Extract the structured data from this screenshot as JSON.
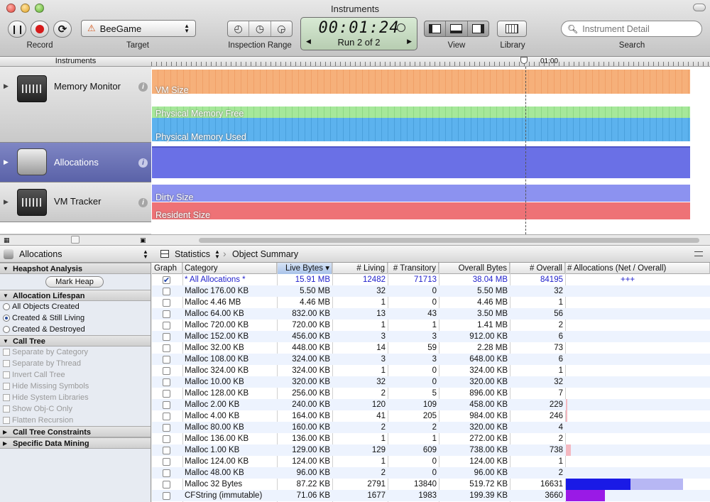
{
  "window": {
    "title": "Instruments"
  },
  "toolbar": {
    "record_label": "Record",
    "target_label": "Target",
    "target_value": "BeeGame",
    "inspection_label": "Inspection Range",
    "timer": "00:01:24",
    "run": "Run 2 of 2",
    "view_label": "View",
    "library_label": "Library",
    "search_label": "Search",
    "search_placeholder": "Instrument Detail"
  },
  "instruments_header": "Instruments",
  "ruler": {
    "marker_label": "01:00"
  },
  "instruments": [
    {
      "name": "Memory Monitor",
      "lanes": [
        "VM Size",
        "Physical Memory Free",
        "Physical Memory Used"
      ]
    },
    {
      "name": "Allocations",
      "lanes": []
    },
    {
      "name": "VM Tracker",
      "lanes": [
        "Dirty Size",
        "Resident Size"
      ]
    }
  ],
  "sidebar": {
    "title": "Allocations",
    "sections": {
      "heapshot": "Heapshot Analysis",
      "mark_heap": "Mark Heap",
      "lifespan": "Allocation Lifespan",
      "lifespan_options": [
        "All Objects Created",
        "Created & Still Living",
        "Created & Destroyed"
      ],
      "lifespan_selected": 1,
      "call_tree": "Call Tree",
      "call_tree_options": [
        "Separate by Category",
        "Separate by Thread",
        "Invert Call Tree",
        "Hide Missing Symbols",
        "Hide System Libraries",
        "Show Obj-C Only",
        "Flatten Recursion"
      ],
      "constraints": "Call Tree Constraints",
      "data_mining": "Specific Data Mining"
    }
  },
  "breadcrumb": {
    "view": "Statistics",
    "detail": "Object Summary"
  },
  "table": {
    "columns": [
      "Graph",
      "Category",
      "Live Bytes",
      "# Living",
      "# Transitory",
      "Overall Bytes",
      "# Overall",
      "# Allocations (Net / Overall)"
    ],
    "all_row": {
      "category": "* All Allocations *",
      "live": "15.91 MB",
      "living": "12482",
      "transitory": "71713",
      "overall_bytes": "38.04 MB",
      "overall": "84195",
      "graph": "+++"
    },
    "rows": [
      {
        "category": "Malloc 176.00 KB",
        "live": "5.50 MB",
        "living": "32",
        "transitory": "0",
        "overall_bytes": "5.50 MB",
        "overall": "32"
      },
      {
        "category": "Malloc 4.46 MB",
        "live": "4.46 MB",
        "living": "1",
        "transitory": "0",
        "overall_bytes": "4.46 MB",
        "overall": "1"
      },
      {
        "category": "Malloc 64.00 KB",
        "live": "832.00 KB",
        "living": "13",
        "transitory": "43",
        "overall_bytes": "3.50 MB",
        "overall": "56"
      },
      {
        "category": "Malloc 720.00 KB",
        "live": "720.00 KB",
        "living": "1",
        "transitory": "1",
        "overall_bytes": "1.41 MB",
        "overall": "2"
      },
      {
        "category": "Malloc 152.00 KB",
        "live": "456.00 KB",
        "living": "3",
        "transitory": "3",
        "overall_bytes": "912.00 KB",
        "overall": "6"
      },
      {
        "category": "Malloc 32.00 KB",
        "live": "448.00 KB",
        "living": "14",
        "transitory": "59",
        "overall_bytes": "2.28 MB",
        "overall": "73"
      },
      {
        "category": "Malloc 108.00 KB",
        "live": "324.00 KB",
        "living": "3",
        "transitory": "3",
        "overall_bytes": "648.00 KB",
        "overall": "6"
      },
      {
        "category": "Malloc 324.00 KB",
        "live": "324.00 KB",
        "living": "1",
        "transitory": "0",
        "overall_bytes": "324.00 KB",
        "overall": "1"
      },
      {
        "category": "Malloc 10.00 KB",
        "live": "320.00 KB",
        "living": "32",
        "transitory": "0",
        "overall_bytes": "320.00 KB",
        "overall": "32"
      },
      {
        "category": "Malloc 128.00 KB",
        "live": "256.00 KB",
        "living": "2",
        "transitory": "5",
        "overall_bytes": "896.00 KB",
        "overall": "7"
      },
      {
        "category": "Malloc 2.00 KB",
        "live": "240.00 KB",
        "living": "120",
        "transitory": "109",
        "overall_bytes": "458.00 KB",
        "overall": "229"
      },
      {
        "category": "Malloc 4.00 KB",
        "live": "164.00 KB",
        "living": "41",
        "transitory": "205",
        "overall_bytes": "984.00 KB",
        "overall": "246"
      },
      {
        "category": "Malloc 80.00 KB",
        "live": "160.00 KB",
        "living": "2",
        "transitory": "2",
        "overall_bytes": "320.00 KB",
        "overall": "4"
      },
      {
        "category": "Malloc 136.00 KB",
        "live": "136.00 KB",
        "living": "1",
        "transitory": "1",
        "overall_bytes": "272.00 KB",
        "overall": "2"
      },
      {
        "category": "Malloc 1.00 KB",
        "live": "129.00 KB",
        "living": "129",
        "transitory": "609",
        "overall_bytes": "738.00 KB",
        "overall": "738"
      },
      {
        "category": "Malloc 124.00 KB",
        "live": "124.00 KB",
        "living": "1",
        "transitory": "0",
        "overall_bytes": "124.00 KB",
        "overall": "1"
      },
      {
        "category": "Malloc 48.00 KB",
        "live": "96.00 KB",
        "living": "2",
        "transitory": "0",
        "overall_bytes": "96.00 KB",
        "overall": "2"
      },
      {
        "category": "Malloc 32 Bytes",
        "live": "87.22 KB",
        "living": "2791",
        "transitory": "13840",
        "overall_bytes": "519.72 KB",
        "overall": "16631"
      },
      {
        "category": "CFString (immutable)",
        "live": "71.06 KB",
        "living": "1677",
        "transitory": "1983",
        "overall_bytes": "199.39 KB",
        "overall": "3660"
      }
    ]
  },
  "colors": {
    "vm_size": "#f6b07a",
    "free": "#a6e89a",
    "used": "#5cb2ee",
    "alloc": "#6a70e6",
    "dirty": "#8c92f0",
    "resident": "#ee7276",
    "net_bar": "#1a1ae6",
    "overall_bar": "#b7b7f4"
  }
}
